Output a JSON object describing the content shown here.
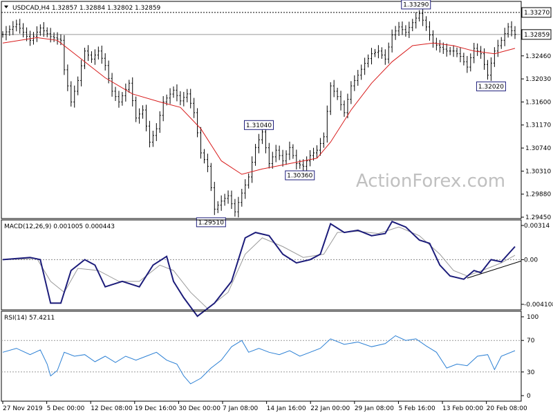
{
  "chart_data": [
    {
      "type": "candlestick",
      "panel": "price",
      "title": "USDCAD,H4  1.32857 1.32884 1.32802 1.32859",
      "symbol": "USDCAD",
      "timeframe": "H4",
      "ohlc_last": {
        "open": 1.32857,
        "high": 1.32884,
        "low": 1.32802,
        "close": 1.32859
      },
      "ylim": [
        1.2945,
        1.3327
      ],
      "y_ticks": [
        "1.33270",
        "1.32859",
        "1.32460",
        "1.32030",
        "1.31600",
        "1.31170",
        "1.30740",
        "1.30310",
        "1.29880",
        "1.29450"
      ],
      "current_price_label": "1.32859",
      "top_level_label": "1.33270",
      "x_ticks": [
        "27 Nov 2019",
        "5 Dec 00:00",
        "12 Dec 08:00",
        "19 Dec 16:00",
        "30 Dec 00:00",
        "7 Jan 08:00",
        "14 Jan 16:00",
        "22 Jan 00:00",
        "29 Jan 08:00",
        "5 Feb 16:00",
        "13 Feb 00:00",
        "20 Feb 08:00"
      ],
      "watermark": "ActionForex.com",
      "annotations": [
        {
          "text": "1.33290",
          "value": 1.3329
        },
        {
          "text": "1.31040",
          "value": 1.3104
        },
        {
          "text": "1.29510",
          "value": 1.2951
        },
        {
          "text": "1.30360",
          "value": 1.3036
        },
        {
          "text": "1.32020",
          "value": 1.3202
        }
      ],
      "price_path": [
        [
          0,
          1.3286
        ],
        [
          4,
          1.3305
        ],
        [
          8,
          1.3275
        ],
        [
          11,
          1.3298
        ],
        [
          14,
          1.3282
        ],
        [
          17,
          1.3275
        ],
        [
          18,
          1.322
        ],
        [
          20,
          1.316
        ],
        [
          22,
          1.32
        ],
        [
          24,
          1.3255
        ],
        [
          26,
          1.324
        ],
        [
          28,
          1.3255
        ],
        [
          30,
          1.3228
        ],
        [
          32,
          1.318
        ],
        [
          34,
          1.316
        ],
        [
          37,
          1.3195
        ],
        [
          39,
          1.313
        ],
        [
          41,
          1.3145
        ],
        [
          43,
          1.3085
        ],
        [
          45,
          1.311
        ],
        [
          47,
          1.316
        ],
        [
          50,
          1.3182
        ],
        [
          52,
          1.3162
        ],
        [
          54,
          1.3175
        ],
        [
          56,
          1.314
        ],
        [
          58,
          1.3065
        ],
        [
          60,
          1.304
        ],
        [
          62,
          1.296
        ],
        [
          64,
          1.2975
        ],
        [
          66,
          1.2985
        ],
        [
          68,
          1.2955
        ],
        [
          70,
          1.299
        ],
        [
          72,
          1.302
        ],
        [
          74,
          1.3075
        ],
        [
          76,
          1.3104
        ],
        [
          78,
          1.3045
        ],
        [
          80,
          1.307
        ],
        [
          82,
          1.305
        ],
        [
          84,
          1.3075
        ],
        [
          86,
          1.3045
        ],
        [
          88,
          1.304
        ],
        [
          90,
          1.306
        ],
        [
          92,
          1.307
        ],
        [
          94,
          1.3095
        ],
        [
          96,
          1.319
        ],
        [
          98,
          1.317
        ],
        [
          100,
          1.314
        ],
        [
          102,
          1.319
        ],
        [
          104,
          1.321
        ],
        [
          106,
          1.3232
        ],
        [
          108,
          1.325
        ],
        [
          110,
          1.3255
        ],
        [
          112,
          1.324
        ],
        [
          114,
          1.3285
        ],
        [
          116,
          1.33
        ],
        [
          118,
          1.329
        ],
        [
          120,
          1.3308
        ],
        [
          122,
          1.3325
        ],
        [
          124,
          1.33
        ],
        [
          126,
          1.327
        ],
        [
          128,
          1.3262
        ],
        [
          130,
          1.3255
        ],
        [
          132,
          1.3255
        ],
        [
          134,
          1.3245
        ],
        [
          136,
          1.3225
        ],
        [
          138,
          1.326
        ],
        [
          140,
          1.325
        ],
        [
          142,
          1.321
        ],
        [
          144,
          1.3255
        ],
        [
          146,
          1.3275
        ],
        [
          148,
          1.33
        ],
        [
          150,
          1.3286
        ]
      ],
      "ma_path": [
        [
          0,
          1.327
        ],
        [
          10,
          1.328
        ],
        [
          16,
          1.3275
        ],
        [
          22,
          1.3245
        ],
        [
          30,
          1.3205
        ],
        [
          38,
          1.3175
        ],
        [
          46,
          1.316
        ],
        [
          52,
          1.315
        ],
        [
          58,
          1.311
        ],
        [
          64,
          1.305
        ],
        [
          70,
          1.3025
        ],
        [
          76,
          1.3035
        ],
        [
          84,
          1.3045
        ],
        [
          92,
          1.3055
        ],
        [
          96,
          1.3085
        ],
        [
          102,
          1.3145
        ],
        [
          108,
          1.3195
        ],
        [
          114,
          1.3235
        ],
        [
          120,
          1.3265
        ],
        [
          126,
          1.327
        ],
        [
          132,
          1.3265
        ],
        [
          138,
          1.3255
        ],
        [
          144,
          1.325
        ],
        [
          150,
          1.326
        ]
      ]
    },
    {
      "type": "line",
      "panel": "macd",
      "title": "MACD(12,26,9) 0.001005 0.000443",
      "params": "12,26,9",
      "values_last": {
        "macd": 0.001005,
        "signal": 0.000443
      },
      "y_ticks": [
        "0.00314",
        "0.00",
        "-0.004108"
      ],
      "ylim": [
        -0.004108,
        0.00314
      ],
      "macd_path": [
        [
          0,
          0.0
        ],
        [
          8,
          0.0002
        ],
        [
          11,
          0.0
        ],
        [
          14,
          -0.004
        ],
        [
          17,
          -0.004
        ],
        [
          20,
          -0.001
        ],
        [
          24,
          0.0
        ],
        [
          27,
          -0.0005
        ],
        [
          30,
          -0.0025
        ],
        [
          35,
          -0.002
        ],
        [
          40,
          -0.0025
        ],
        [
          44,
          -0.0005
        ],
        [
          48,
          0.0003
        ],
        [
          50,
          -0.002
        ],
        [
          53,
          -0.0035
        ],
        [
          57,
          -0.0052
        ],
        [
          62,
          -0.004
        ],
        [
          67,
          -0.002
        ],
        [
          71,
          0.002
        ],
        [
          74,
          0.0025
        ],
        [
          78,
          0.0022
        ],
        [
          82,
          0.0005
        ],
        [
          86,
          -0.0003
        ],
        [
          90,
          0.0
        ],
        [
          93,
          0.0005
        ],
        [
          96,
          0.0033
        ],
        [
          100,
          0.0025
        ],
        [
          104,
          0.0027
        ],
        [
          108,
          0.0022
        ],
        [
          112,
          0.0024
        ],
        [
          114,
          0.0035
        ],
        [
          118,
          0.003
        ],
        [
          122,
          0.0018
        ],
        [
          125,
          0.0015
        ],
        [
          128,
          -0.0005
        ],
        [
          131,
          -0.0015
        ],
        [
          135,
          -0.0018
        ],
        [
          138,
          -0.001
        ],
        [
          140,
          -0.0012
        ],
        [
          143,
          0.0
        ],
        [
          146,
          -0.0002
        ],
        [
          150,
          0.0012
        ]
      ],
      "signal_path": [
        [
          0,
          0.0
        ],
        [
          10,
          0.0001
        ],
        [
          14,
          -0.002
        ],
        [
          18,
          -0.003
        ],
        [
          22,
          -0.0008
        ],
        [
          28,
          -0.001
        ],
        [
          34,
          -0.002
        ],
        [
          40,
          -0.002
        ],
        [
          46,
          -0.0005
        ],
        [
          50,
          -0.001
        ],
        [
          55,
          -0.003
        ],
        [
          60,
          -0.0045
        ],
        [
          66,
          -0.003
        ],
        [
          71,
          0.0005
        ],
        [
          76,
          0.002
        ],
        [
          82,
          0.0012
        ],
        [
          88,
          0.0002
        ],
        [
          94,
          0.0005
        ],
        [
          98,
          0.0025
        ],
        [
          104,
          0.0026
        ],
        [
          110,
          0.0024
        ],
        [
          116,
          0.003
        ],
        [
          122,
          0.0022
        ],
        [
          128,
          0.0005
        ],
        [
          132,
          -0.001
        ],
        [
          136,
          -0.0015
        ],
        [
          142,
          -0.0008
        ],
        [
          146,
          -0.0003
        ],
        [
          150,
          0.0004
        ]
      ],
      "trendline": [
        [
          136,
          -0.0017
        ],
        [
          150,
          0.0
        ]
      ]
    },
    {
      "type": "line",
      "panel": "rsi",
      "title": "RSI(14) 57.4211",
      "period": 14,
      "value_last": 57.4211,
      "y_ticks": [
        "100",
        "70",
        "30",
        "0"
      ],
      "ylim": [
        0,
        100
      ],
      "levels": [
        70,
        30
      ],
      "rsi_path": [
        [
          0,
          55
        ],
        [
          4,
          60
        ],
        [
          8,
          52
        ],
        [
          11,
          58
        ],
        [
          13,
          40
        ],
        [
          14,
          25
        ],
        [
          16,
          32
        ],
        [
          18,
          55
        ],
        [
          21,
          50
        ],
        [
          24,
          52
        ],
        [
          27,
          43
        ],
        [
          30,
          50
        ],
        [
          33,
          42
        ],
        [
          36,
          50
        ],
        [
          39,
          45
        ],
        [
          42,
          50
        ],
        [
          45,
          55
        ],
        [
          48,
          45
        ],
        [
          51,
          40
        ],
        [
          53,
          25
        ],
        [
          55,
          15
        ],
        [
          58,
          22
        ],
        [
          61,
          35
        ],
        [
          64,
          45
        ],
        [
          67,
          62
        ],
        [
          70,
          70
        ],
        [
          72,
          55
        ],
        [
          75,
          60
        ],
        [
          78,
          55
        ],
        [
          81,
          52
        ],
        [
          84,
          57
        ],
        [
          87,
          50
        ],
        [
          90,
          55
        ],
        [
          93,
          60
        ],
        [
          96,
          72
        ],
        [
          100,
          65
        ],
        [
          104,
          68
        ],
        [
          108,
          62
        ],
        [
          112,
          66
        ],
        [
          115,
          76
        ],
        [
          118,
          70
        ],
        [
          121,
          72
        ],
        [
          124,
          63
        ],
        [
          127,
          55
        ],
        [
          130,
          35
        ],
        [
          133,
          40
        ],
        [
          136,
          38
        ],
        [
          139,
          50
        ],
        [
          142,
          52
        ],
        [
          144,
          33
        ],
        [
          146,
          50
        ],
        [
          150,
          57
        ]
      ]
    }
  ]
}
